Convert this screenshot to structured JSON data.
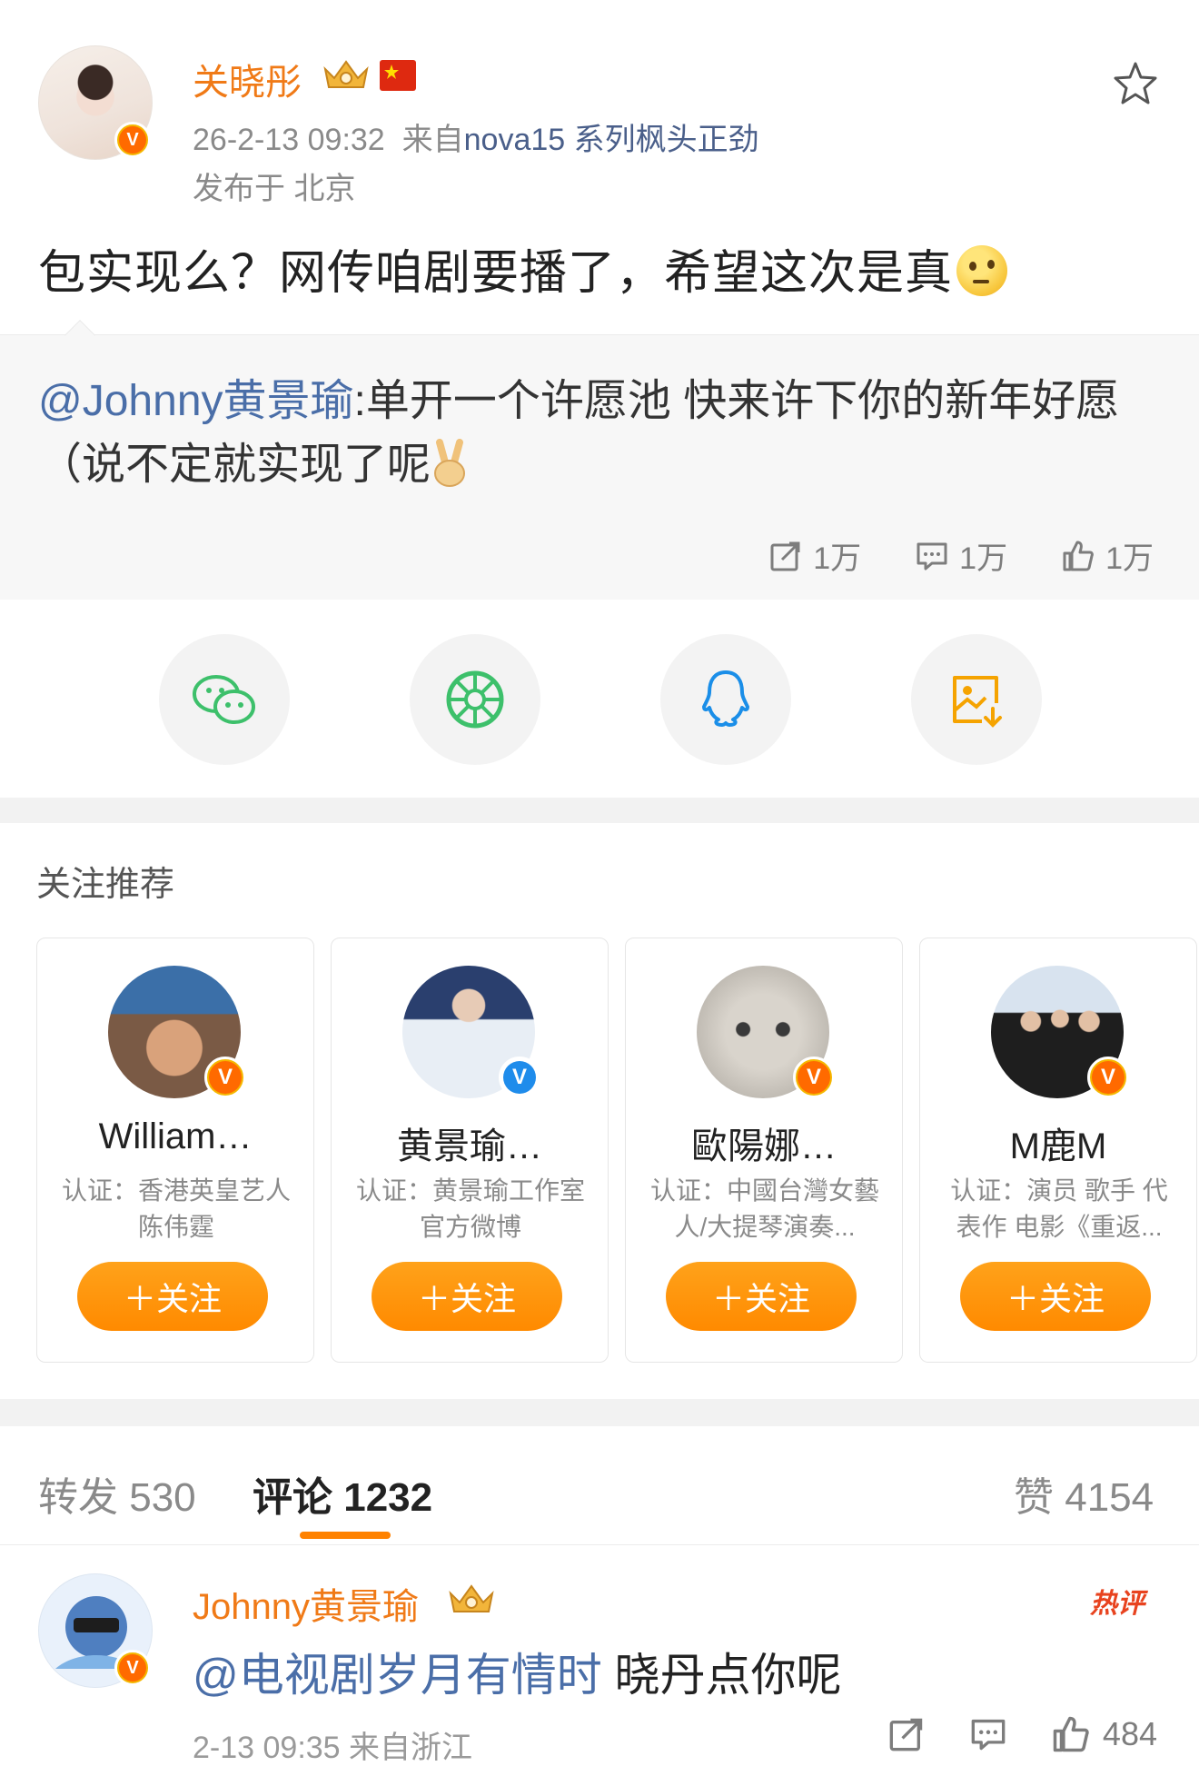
{
  "post": {
    "author": "关晓彤",
    "time": "26-2-13 09:32",
    "source_prefix": "来自",
    "source": "nova15 系列枫头正劲",
    "location": "发布于 北京",
    "text": "包实现么？网传咱剧要播了，希望这次是真"
  },
  "repost": {
    "mention": "@Johnny黄景瑜",
    "text": ":单开一个许愿池 快来许下你的新年好愿（说不定就实现了呢",
    "shares": "1万",
    "comments": "1万",
    "likes": "1万"
  },
  "recommend": {
    "title": "关注推荐",
    "follow_label": "＋关注",
    "cards": [
      {
        "name": "William…",
        "desc": "认证：香港英皇艺人陈伟霆",
        "badge": "orange"
      },
      {
        "name": "黄景瑜…",
        "desc": "认证：黄景瑜工作室官方微博",
        "badge": "blue"
      },
      {
        "name": "歐陽娜…",
        "desc": "认证：中國台灣女藝人/大提琴演奏...",
        "badge": "orange"
      },
      {
        "name": "M鹿M",
        "desc": "认证：演员 歌手 代表作 电影《重返...",
        "badge": "orange"
      }
    ]
  },
  "tabs": {
    "repost": "转发 530",
    "comment": "评论 1232",
    "like": "赞 4154"
  },
  "comment": {
    "author": "Johnny黄景瑜",
    "hot": "热评",
    "mention": "@电视剧岁月有情时",
    "text": " 晓丹点你呢",
    "meta": "2-13 09:35 来自浙江",
    "likes": "484"
  },
  "colors": {
    "accent": "#ff8200",
    "name": "#f07a17",
    "link": "#4a6ea8"
  },
  "icons": [
    "star-icon",
    "crown-icon",
    "flag-icon",
    "share-icon",
    "comment-icon",
    "like-icon",
    "wechat-icon",
    "moments-icon",
    "qq-icon",
    "save-image-icon"
  ]
}
